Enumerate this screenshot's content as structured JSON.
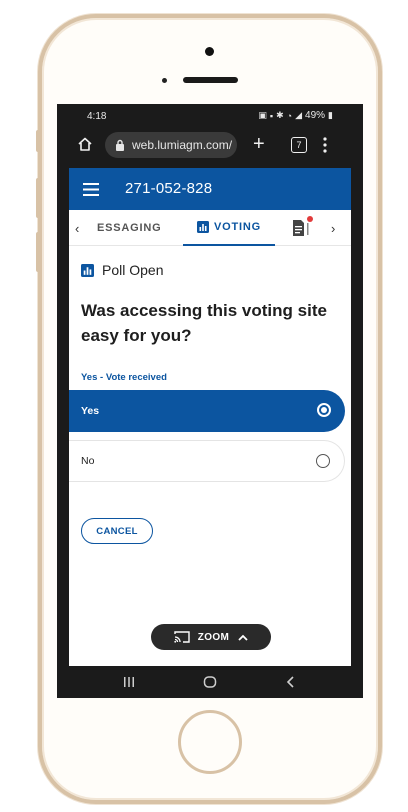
{
  "status_bar": {
    "time": "4:18",
    "battery": "49%"
  },
  "browser": {
    "url": "web.lumiagm.com/",
    "tab_count": "7"
  },
  "header": {
    "meeting_id": "271-052-828"
  },
  "tabs": {
    "prev": "‹",
    "messaging": "ESSAGING",
    "voting": "VOTING",
    "next": "›"
  },
  "poll": {
    "status": "Poll Open",
    "question": "Was accessing this voting site easy for you?",
    "vote_status": "Yes - Vote received",
    "options": [
      {
        "label": "Yes",
        "selected": true
      },
      {
        "label": "No",
        "selected": false
      }
    ],
    "cancel_label": "CANCEL"
  },
  "zoom": {
    "label": "ZOOM"
  },
  "colors": {
    "brand_blue": "#0c55a0",
    "notification_red": "#e23b3b",
    "phone_trim": "#d8c2a6"
  },
  "icons": [
    "home-icon",
    "lock-icon",
    "plus-icon",
    "tabs-icon",
    "kebab-icon",
    "hamburger-icon",
    "chart-icon",
    "document-icon",
    "cast-icon",
    "chevron-up-icon"
  ]
}
